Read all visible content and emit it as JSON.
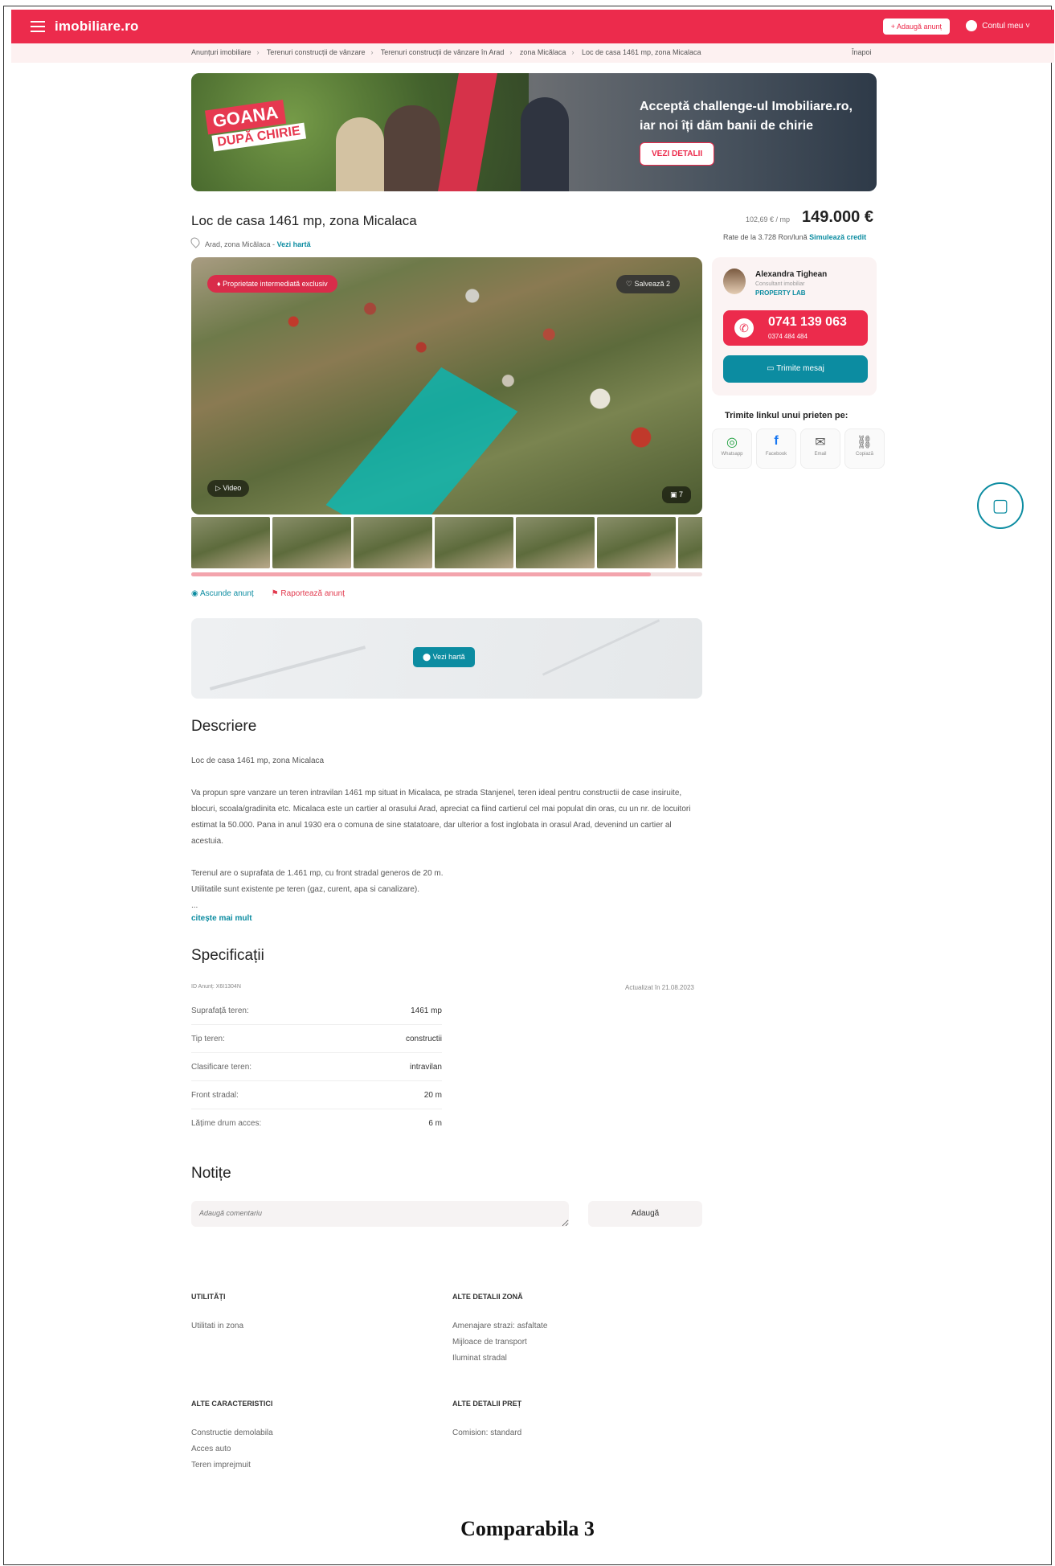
{
  "header": {
    "logo": "imobiliare.ro",
    "add_listing": "+ Adaugă anunț",
    "account": "Contul meu ˅"
  },
  "breadcrumb": {
    "items": [
      "Anunțuri imobiliare",
      "Terenuri construcții de vânzare",
      "Terenuri construcții de vânzare în Arad",
      "zona Micălaca",
      "Loc de casa 1461 mp, zona Micalaca"
    ],
    "back": "Înapoi"
  },
  "banner": {
    "flag_line1": "GOANA",
    "flag_line2": "DUPĂ CHIRIE",
    "headline": "Acceptă challenge-ul Imobiliare.ro, iar noi îți dăm banii de chirie",
    "cta": "VEZI DETALII"
  },
  "listing": {
    "title": "Loc de casa 1461 mp, zona Micalaca",
    "location": "Arad, zona Micălaca -",
    "map_link": "Vezi hartă",
    "price_per_sqm": "102,69 € / mp",
    "price": "149.000 €",
    "rate_text": "Rate de la 3.728 Ron/lună",
    "rate_link": "Simulează credit"
  },
  "gallery": {
    "exclusive_badge": "Proprietate intermediată exclusiv",
    "save": "Salvează",
    "save_count": "2",
    "video": "Video",
    "photo_count": "7",
    "progress": 0.9
  },
  "actions": {
    "hide": "Ascunde anunț",
    "report": "Raportează anunț"
  },
  "map": {
    "button": "Vezi hartă"
  },
  "agent": {
    "name": "Alexandra Tighean",
    "role": "Consultant imobiliar",
    "company": "PROPERTY LAB",
    "phone": "0741 139 063",
    "phone_alt": "0374 484 484",
    "message": "Trimite mesaj"
  },
  "share": {
    "title": "Trimite linkul unui prieten pe:",
    "items": [
      "Whatsapp",
      "Facebook",
      "Email",
      "Copiază"
    ]
  },
  "description": {
    "heading": "Descriere",
    "p1": "Loc de casa 1461 mp, zona Micalaca",
    "p2": "Va propun spre vanzare un teren intravilan 1461 mp situat in Micalaca, pe strada Stanjenel, teren ideal pentru constructii de case insiruite, blocuri, scoala/gradinita etc. Micalaca este un cartier al orasului Arad, apreciat ca fiind cartierul cel mai populat din oras, cu un nr. de locuitori estimat la 50.000. Pana in anul 1930 era o comuna de sine statatoare, dar ulterior a fost inglobata in orasul Arad, devenind un cartier al acestuia.",
    "p3a": "Terenul are o suprafata de 1.461 mp, cu front stradal generos de 20 m.",
    "p3b": "Utilitatile sunt existente pe teren (gaz, curent, apa si canalizare).",
    "ellipsis": "...",
    "more": "citește mai mult"
  },
  "specs": {
    "heading": "Specificații",
    "id": "ID Anunț: X6I1304N",
    "updated": "Actualizat în 21.08.2023",
    "rows": [
      {
        "k": "Suprafață teren:",
        "v": "1461 mp"
      },
      {
        "k": "Tip teren:",
        "v": "constructii"
      },
      {
        "k": "Clasificare teren:",
        "v": "intravilan"
      },
      {
        "k": "Front stradal:",
        "v": "20 m"
      },
      {
        "k": "Lățime drum acces:",
        "v": "6 m"
      }
    ]
  },
  "notes": {
    "heading": "Notițe",
    "placeholder": "Adaugă comentariu",
    "button": "Adaugă"
  },
  "details": {
    "utilities_h": "UTILITĂȚI",
    "utilities": [
      "Utilitati in zona"
    ],
    "zone_h": "ALTE DETALII ZONĂ",
    "zone": [
      "Amenajare strazi: asfaltate",
      "Mijloace de transport",
      "Iluminat stradal"
    ],
    "features_h": "ALTE CARACTERISTICI",
    "features": [
      "Constructie demolabila",
      "Acces auto",
      "Teren imprejmuit"
    ],
    "price_h": "ALTE DETALII PREȚ",
    "price": [
      "Comision: standard"
    ]
  },
  "caption": "Comparabila 3",
  "colors": {
    "brand": "#ec2b4c",
    "accent": "#0c8ca1"
  }
}
